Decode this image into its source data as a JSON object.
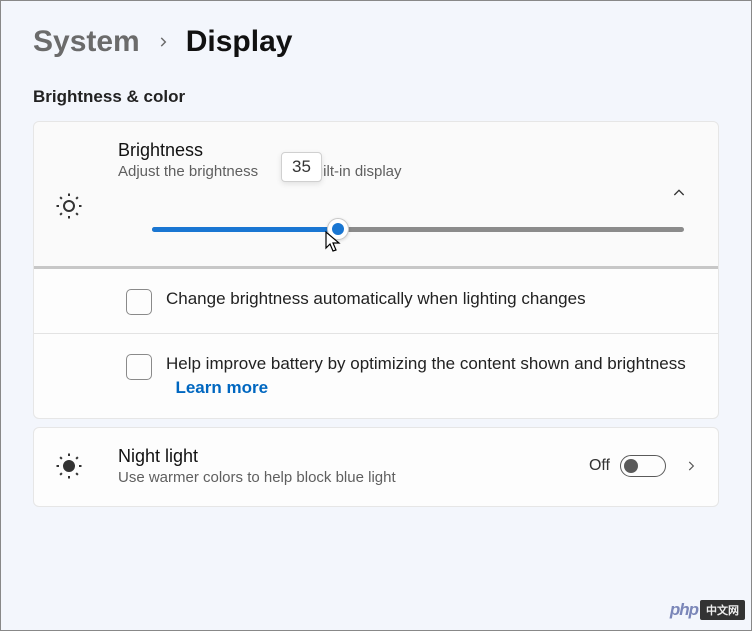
{
  "breadcrumb": {
    "parent": "System",
    "current": "Display"
  },
  "section_title": "Brightness & color",
  "brightness": {
    "title": "Brightness",
    "desc_pre": "Adjust the brightness",
    "desc_post": "built-in display",
    "value": 35,
    "tooltip": "35",
    "percent": 35
  },
  "auto_brightness": {
    "label": "Change brightness automatically when lighting changes",
    "checked": false
  },
  "battery_opt": {
    "label": "Help improve battery by optimizing the content shown and brightness",
    "learn_more": "Learn more",
    "checked": false
  },
  "night_light": {
    "title": "Night light",
    "desc": "Use warmer colors to help block blue light",
    "state_label": "Off",
    "on": false
  },
  "watermark": {
    "left": "php",
    "right": "中文网"
  }
}
